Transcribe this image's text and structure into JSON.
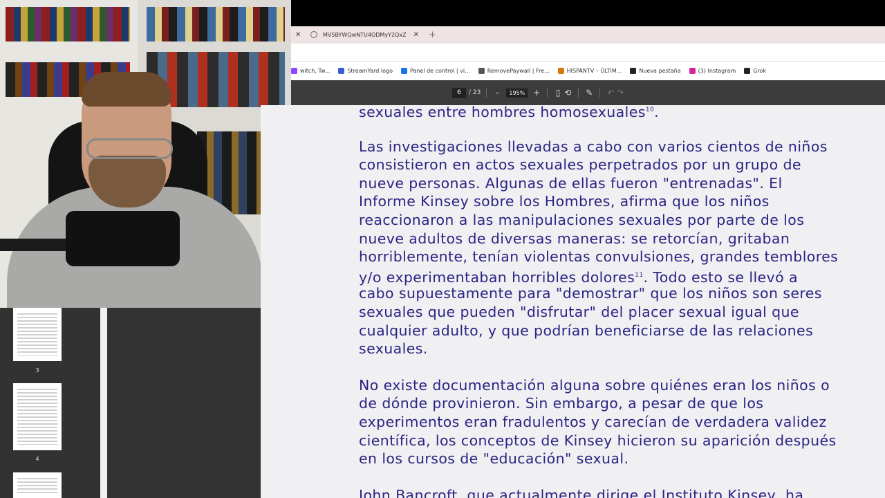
{
  "browser": {
    "tab": {
      "title": "MV5BYWQwNTU4ODMyY2QxZ"
    },
    "bookmarks": [
      {
        "label": "witch, Tw...",
        "icon": "twitch-icon",
        "color": "#9146ff"
      },
      {
        "label": "StreamYard logo",
        "icon": "streamyard-icon",
        "color": "#3b5bdb"
      },
      {
        "label": "Panel de control | vi...",
        "icon": "panel-icon",
        "color": "#1a73e8"
      },
      {
        "label": "RemovePaywall | Fre...",
        "icon": "removepaywall-icon",
        "color": "#555555"
      },
      {
        "label": "HISPANTV – ÚLTIM...",
        "icon": "hispantv-icon",
        "color": "#d97706"
      },
      {
        "label": "Nueva pestaña",
        "icon": "globe-icon",
        "color": "#222222"
      },
      {
        "label": "(3) Instagram",
        "icon": "instagram-icon",
        "color": "#d6249f"
      },
      {
        "label": "Grok",
        "icon": "grok-icon",
        "color": "#222222"
      }
    ]
  },
  "pdf_toolbar": {
    "page": "6",
    "total": "/ 23",
    "zoom": "195%",
    "zoom_out": "–",
    "zoom_in": "+"
  },
  "sidebar": {
    "thumbs": [
      {
        "num": "3"
      },
      {
        "num": "4"
      }
    ]
  },
  "document": {
    "paragraphs": [
      {
        "lines": [
          "sexuales entre hombres homosexuales"
        ],
        "sup": "10",
        "end": "."
      },
      {
        "lines": [
          "Las investigaciones llevadas a cabo con varios cientos de niños",
          "consistieron en actos sexuales perpetrados por un grupo de",
          "nueve personas. Algunas de ellas fueron \"entrenadas\". El",
          "Informe Kinsey sobre los Hombres, afirma que los niños",
          "reaccionaron a las manipulaciones sexuales por parte de los",
          "nueve adultos de diversas maneras: se retorcían, gritaban",
          "horriblemente, tenían violentas convulsiones, grandes temblores"
        ]
      },
      {
        "lines": [
          "y/o experimentaban horribles dolores"
        ],
        "sup": "11",
        "end": ". Todo esto se llevó a"
      },
      {
        "lines": [
          "cabo supuestamente para \"demostrar\" que los niños son seres",
          "sexuales que pueden \"disfrutar\" del placer sexual igual que",
          "cualquier adulto, y que podrían beneficiarse de las relaciones",
          "sexuales."
        ]
      },
      {
        "lines": [
          "No existe documentación alguna sobre quiénes eran los niños o",
          "de dónde provinieron. Sin embargo, a pesar de que los",
          "experimentos eran fradulentos y carecían de verdadera validez",
          "científica, los conceptos de Kinsey hicieron su aparición después",
          "en los cursos de \"educación\" sexual."
        ]
      },
      {
        "lines": [
          "John Bancroft, que actualmente dirige el Instituto Kinsey, ha"
        ]
      }
    ]
  }
}
